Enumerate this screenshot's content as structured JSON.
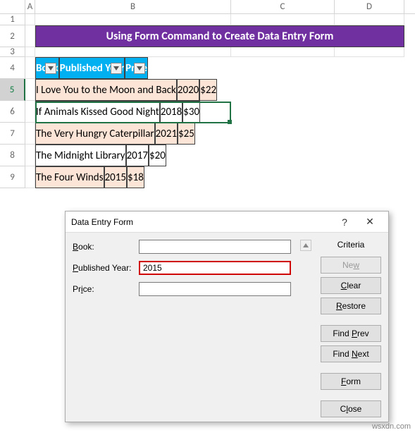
{
  "columns": {
    "a": "A",
    "b": "B",
    "c": "C",
    "d": "D"
  },
  "row_nums": {
    "r1": "1",
    "r2": "2",
    "r3": "3",
    "r4": "4",
    "r5": "5",
    "r6": "6",
    "r7": "7",
    "r8": "8",
    "r9": "9"
  },
  "title": "Using Form Command to Create Data Entry Form",
  "headers": {
    "book": "Book",
    "year": "Published Year",
    "price": "Price"
  },
  "rows": [
    {
      "book": "I Love You to the Moon and Back",
      "year": "2020",
      "price": "$22"
    },
    {
      "book": "If Animals Kissed Good Night",
      "year": "2018",
      "price": "$30"
    },
    {
      "book": "The Very Hungry Caterpillar",
      "year": "2021",
      "price": "$25"
    },
    {
      "book": "The Midnight Library",
      "year": "2017",
      "price": "$20"
    },
    {
      "book": "The Four Winds",
      "year": "2015",
      "price": "$18"
    }
  ],
  "dialog": {
    "title": "Data Entry Form",
    "help": "?",
    "close": "✕",
    "labels": {
      "book_pre": "B",
      "book_post": "ook:",
      "year_pre": "P",
      "year_post": "ublished Year:",
      "price_pre": "Pr",
      "price_post": "ice:"
    },
    "values": {
      "book": "",
      "year": "2015",
      "price": ""
    },
    "criteria": "Criteria",
    "buttons": {
      "new_pre": "Ne",
      "new_u": "w",
      "clear_u": "C",
      "clear_post": "lear",
      "restore_u": "R",
      "restore_post": "estore",
      "findprev_pre": "Find ",
      "findprev_u": "P",
      "findprev_post": "rev",
      "findnext_pre": "Find ",
      "findnext_u": "N",
      "findnext_post": "ext",
      "form_u": "F",
      "form_post": "orm",
      "close_pre": "C",
      "close_u": "l",
      "close_post": "ose"
    }
  },
  "watermark": "wsxdn.com"
}
